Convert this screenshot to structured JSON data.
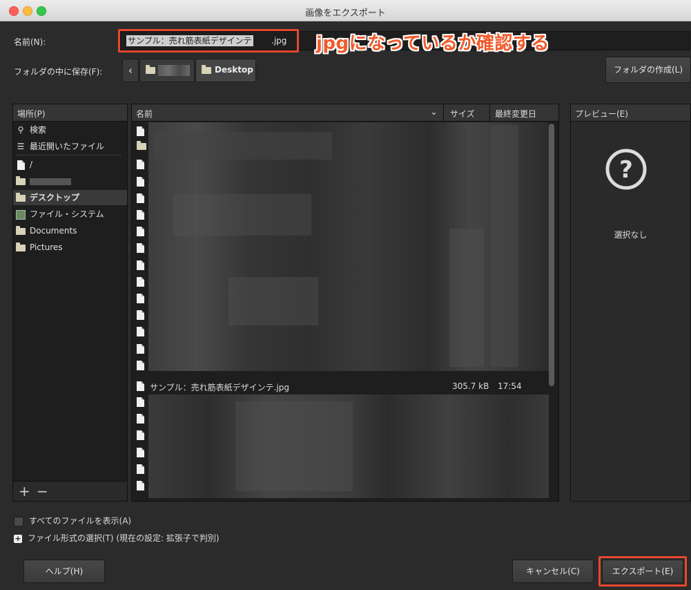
{
  "window": {
    "title": "画像をエクスポート"
  },
  "name_row": {
    "label": "名前(N):",
    "filename_selected": "サンプル：売れ筋表紙デザインテ",
    "filename_ext": ".jpg"
  },
  "annotation": {
    "text": "jpgになっているか確認する",
    "color": "#f25a2a"
  },
  "folder_row": {
    "label": "フォルダの中に保存(F):",
    "crumb_current": "Desktop",
    "create_folder": "フォルダの作成(L)"
  },
  "places": {
    "header": "場所(P)",
    "items": [
      {
        "label": "検索",
        "icon": "search-icon"
      },
      {
        "label": "最近開いたファイル",
        "icon": "recent-icon"
      },
      {
        "label": "/",
        "icon": "file-icon"
      },
      {
        "label": "",
        "icon": "folder-icon"
      },
      {
        "label": "デスクトップ",
        "icon": "folder-icon",
        "selected": true
      },
      {
        "label": "ファイル・システム",
        "icon": "drive-icon"
      },
      {
        "label": "Documents",
        "icon": "folder-icon"
      },
      {
        "label": "Pictures",
        "icon": "folder-icon"
      }
    ],
    "add": "+",
    "remove": "−"
  },
  "files": {
    "col_name": "名前",
    "col_size": "サイズ",
    "col_modified": "最終変更日",
    "visible_row": {
      "name": "サンプル：売れ筋表紙デザインテ.jpg",
      "size": "305.7 kB",
      "modified": "17:54"
    }
  },
  "preview": {
    "header": "プレビュー(E)",
    "empty": "選択なし",
    "icon": "question-icon"
  },
  "options": {
    "show_all": "すべてのファイルを表示(A)",
    "file_type": "ファイル形式の選択(T) (現在の設定: 拡張子で判別)"
  },
  "buttons": {
    "help": "ヘルプ(H)",
    "cancel": "キャンセル(C)",
    "export": "エクスポート(E)"
  }
}
